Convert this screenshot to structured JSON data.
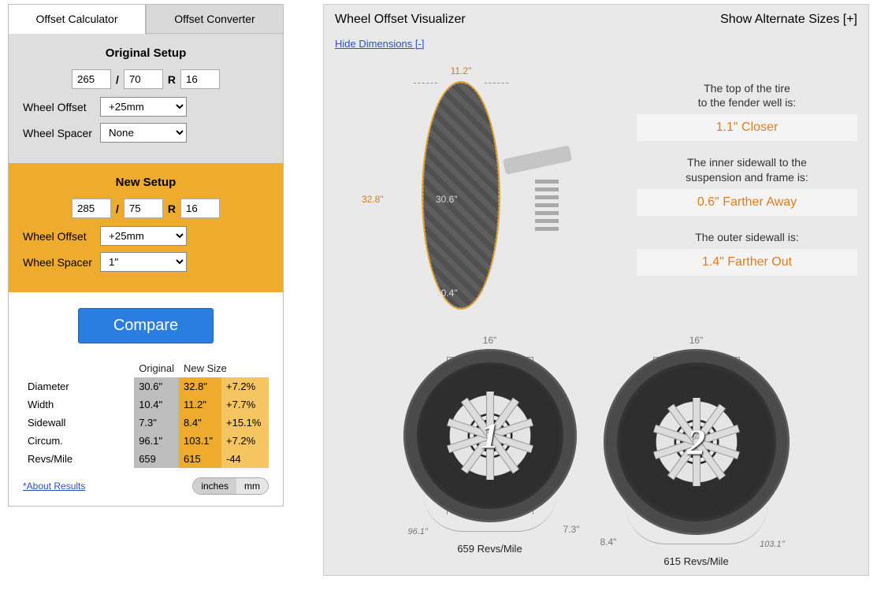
{
  "tabs": {
    "calculator": "Offset Calculator",
    "converter": "Offset Converter"
  },
  "original": {
    "title": "Original Setup",
    "width": "265",
    "aspect": "70",
    "rim": "16",
    "offset_label": "Wheel Offset",
    "offset_value": "+25mm",
    "spacer_label": "Wheel Spacer",
    "spacer_value": "None"
  },
  "newsetup": {
    "title": "New Setup",
    "width": "285",
    "aspect": "75",
    "rim": "16",
    "offset_label": "Wheel Offset",
    "offset_value": "+25mm",
    "spacer_label": "Wheel Spacer",
    "spacer_value": "1\""
  },
  "compare": "Compare",
  "table": {
    "head_orig": "Original",
    "head_new": "New Size",
    "rows": [
      {
        "label": "Diameter",
        "orig": "30.6\"",
        "new": "32.8\"",
        "diff": "+7.2%"
      },
      {
        "label": "Width",
        "orig": "10.4\"",
        "new": "11.2\"",
        "diff": "+7.7%"
      },
      {
        "label": "Sidewall",
        "orig": "7.3\"",
        "new": "8.4\"",
        "diff": "+15.1%"
      },
      {
        "label": "Circum.",
        "orig": "96.1\"",
        "new": "103.1\"",
        "diff": "+7.2%"
      },
      {
        "label": "Revs/Mile",
        "orig": "659",
        "new": "615",
        "diff": "-44"
      }
    ],
    "about": "*About Results",
    "units_in": "inches",
    "units_mm": "mm"
  },
  "right": {
    "title": "Wheel Offset Visualizer",
    "show_alt": "Show Alternate Sizes [+]",
    "hide_dim": "Hide Dimensions [-]",
    "side": {
      "top": "11.2\"",
      "height": "32.8\"",
      "inner1": "30.6\"",
      "inner2": "10.4\""
    },
    "cards": [
      {
        "label": "The top of the tire\nto the fender well is:",
        "value": "1.1\" Closer"
      },
      {
        "label": "The inner sidewall to the\nsuspension and frame is:",
        "value": "0.6\" Farther Away"
      },
      {
        "label": "The outer sidewall is:",
        "value": "1.4\" Farther Out"
      }
    ],
    "wheel1": {
      "rim": "16\"",
      "num": "1",
      "circ": "96.1\"",
      "side": "7.3\"",
      "revs": "659 Revs/Mile"
    },
    "wheel2": {
      "rim": "16\"",
      "num": "2",
      "circ": "103.1\"",
      "side": "8.4\"",
      "revs": "615 Revs/Mile"
    }
  }
}
